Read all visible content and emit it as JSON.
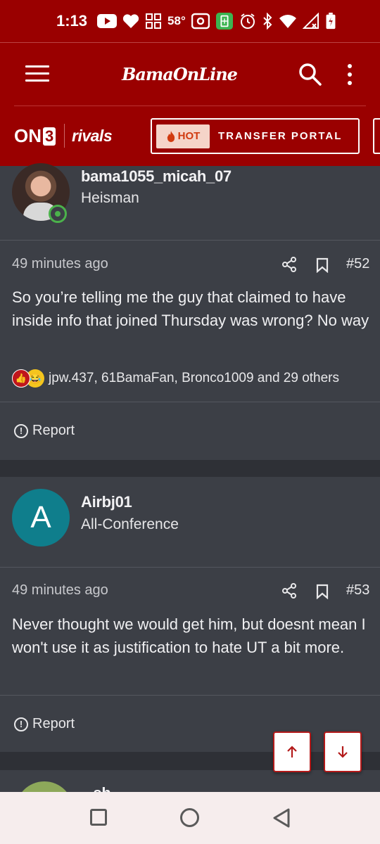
{
  "status_bar": {
    "time": "1:13",
    "temperature": "58°",
    "icons": [
      "youtube-icon",
      "heart-icon",
      "grid-icon",
      "temperature",
      "nfc-icon",
      "battery-saver-icon",
      "alarm-icon",
      "bluetooth-icon",
      "wifi-icon",
      "signal-icon",
      "battery-icon"
    ]
  },
  "header": {
    "logo_text": "BamaOnLine"
  },
  "sub_header": {
    "on3_prefix": "ON",
    "on3_suffix": "3",
    "rivals": "rivals",
    "hot_label": "HOT",
    "portal_label": "TRANSFER PORTAL"
  },
  "posts": [
    {
      "username": "bama1055_micah_07",
      "user_title": "Heisman",
      "online": true,
      "avatar_type": "photo",
      "time": "49 minutes ago",
      "post_number": "#52",
      "text": "So you’re telling me the guy that claimed to have inside info that joined Thursday was wrong? No way",
      "reactions_text": "jpw.437, 61BamaFan, Bronco1009 and 29 others",
      "report_label": "Report"
    },
    {
      "username": "Airbj01",
      "user_title": "All-Conference",
      "avatar_letter": "A",
      "avatar_color": "#0f7e8c",
      "time": "49 minutes ago",
      "post_number": "#53",
      "text": "Never thought we would get him, but doesnt mean I won't use it as justification to hate UT a bit more.",
      "report_label": "Report"
    },
    {
      "username": "...sh",
      "partial": true
    }
  ],
  "colors": {
    "brand_red": "#9a0000",
    "post_bg": "#3c3f46",
    "page_bg": "#2e3036",
    "online_green": "#4bb24b"
  }
}
